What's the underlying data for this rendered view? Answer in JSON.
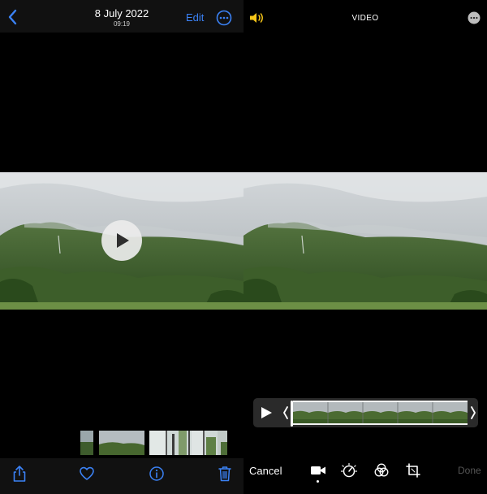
{
  "viewer": {
    "date": "8 July 2022",
    "time": "09:19",
    "edit_label": "Edit"
  },
  "editor": {
    "mode_label": "VIDEO",
    "cancel_label": "Cancel",
    "done_label": "Done"
  },
  "icons": {
    "back": "chevron-left-icon",
    "more": "ellipsis-circle-icon",
    "play": "play-icon",
    "share": "share-icon",
    "favorite": "heart-icon",
    "info": "info-icon",
    "delete": "trash-icon",
    "sound": "speaker-icon",
    "video_tool": "video-camera-icon",
    "adjust_tool": "adjust-dial-icon",
    "filters_tool": "filters-icon",
    "crop_tool": "crop-icon"
  },
  "colors": {
    "accent": "#3b82f6",
    "sound_on": "#f5c518",
    "done_disabled": "#555555",
    "background": "#000000"
  }
}
